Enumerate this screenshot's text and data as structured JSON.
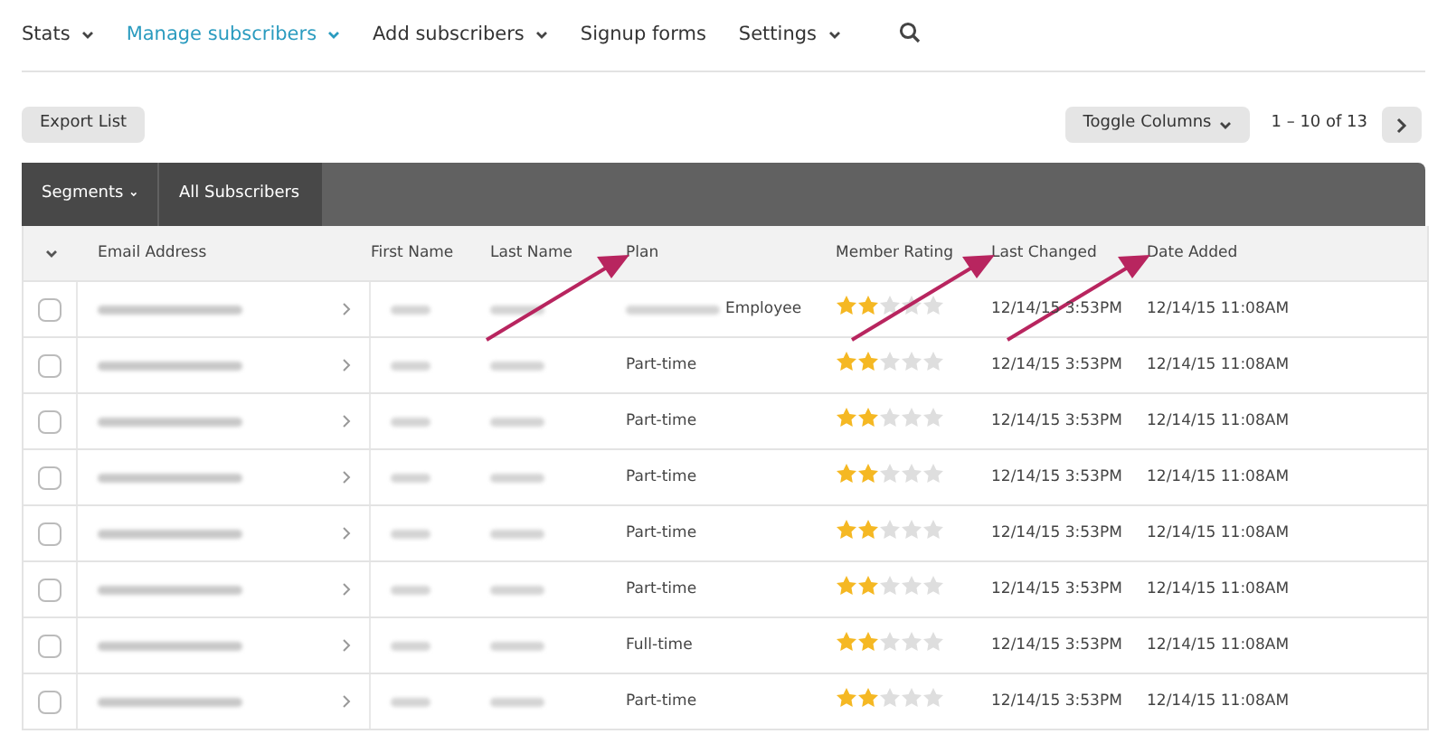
{
  "nav": [
    {
      "label": "Stats",
      "dropdown": true,
      "selected": false
    },
    {
      "label": "Manage subscribers",
      "dropdown": true,
      "selected": true
    },
    {
      "label": "Add subscribers",
      "dropdown": true,
      "selected": false
    },
    {
      "label": "Signup forms",
      "dropdown": false,
      "selected": false
    },
    {
      "label": "Settings",
      "dropdown": true,
      "selected": false
    }
  ],
  "toolbar": {
    "export": "Export List",
    "toggle": "Toggle Columns",
    "pagination": "1 – 10 of 13"
  },
  "filter_bar": {
    "segments": "Segments",
    "list": "All Subscribers"
  },
  "table": {
    "columns": [
      {
        "label": "Email Address",
        "arrow": false
      },
      {
        "label": "First Name",
        "arrow": false
      },
      {
        "label": "Last Name",
        "arrow": false
      },
      {
        "label": "Plan",
        "arrow": true
      },
      {
        "label": "Member Rating",
        "arrow": false
      },
      {
        "label": "Last Changed",
        "arrow": true
      },
      {
        "label": "Date Added",
        "arrow": true
      }
    ],
    "rows": [
      {
        "checked": false,
        "plan_redacted": true,
        "plan": "Employee",
        "stars": 2,
        "last_changed": "12/14/15 3:53PM",
        "date_added": "12/14/15 11:08AM"
      },
      {
        "checked": false,
        "plan_redacted": false,
        "plan": "Part-time",
        "stars": 2,
        "last_changed": "12/14/15 3:53PM",
        "date_added": "12/14/15 11:08AM"
      },
      {
        "checked": false,
        "plan_redacted": false,
        "plan": "Part-time",
        "stars": 2,
        "last_changed": "12/14/15 3:53PM",
        "date_added": "12/14/15 11:08AM"
      },
      {
        "checked": false,
        "plan_redacted": false,
        "plan": "Part-time",
        "stars": 2,
        "last_changed": "12/14/15 3:53PM",
        "date_added": "12/14/15 11:08AM"
      },
      {
        "checked": false,
        "plan_redacted": false,
        "plan": "Part-time",
        "stars": 2,
        "last_changed": "12/14/15 3:53PM",
        "date_added": "12/14/15 11:08AM"
      },
      {
        "checked": false,
        "plan_redacted": false,
        "plan": "Part-time",
        "stars": 2,
        "last_changed": "12/14/15 3:53PM",
        "date_added": "12/14/15 11:08AM"
      },
      {
        "checked": false,
        "plan_redacted": false,
        "plan": "Full-time",
        "stars": 2,
        "last_changed": "12/14/15 3:53PM",
        "date_added": "12/14/15 11:08AM"
      },
      {
        "checked": false,
        "plan_redacted": false,
        "plan": "Part-time",
        "stars": 2,
        "last_changed": "12/14/15 3:53PM",
        "date_added": "12/14/15 11:08AM"
      }
    ]
  }
}
